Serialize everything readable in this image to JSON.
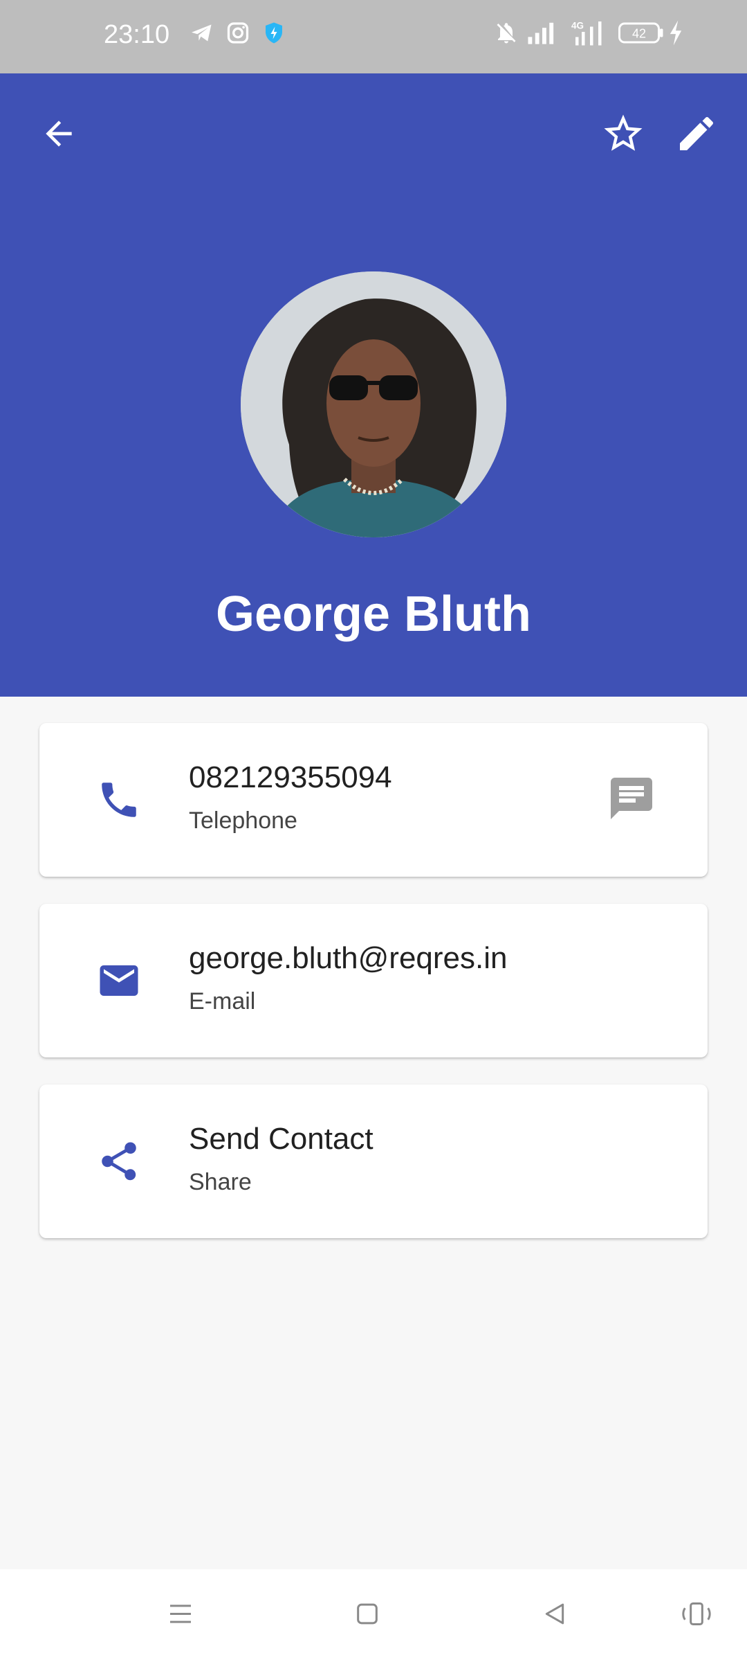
{
  "status_bar": {
    "time": "23:10",
    "left_icons": [
      "telegram-icon",
      "instagram-icon",
      "shield-bolt-icon"
    ],
    "right_icons": [
      "bell-off-icon",
      "signal-icon",
      "signal-4g-icon",
      "battery-icon",
      "charging-icon"
    ],
    "battery_level": "42"
  },
  "header": {
    "back_icon": "arrow-left-icon",
    "favorite_icon": "star-outline-icon",
    "edit_icon": "pencil-icon",
    "name": "George Bluth",
    "avatar_alt": "George Bluth avatar"
  },
  "cards": [
    {
      "icon": "phone-icon",
      "primary": "082129355094",
      "secondary": "Telephone",
      "action_icon": "message-icon"
    },
    {
      "icon": "email-icon",
      "primary": "george.bluth@reqres.in",
      "secondary": "E-mail"
    },
    {
      "icon": "share-icon",
      "primary": "Send Contact",
      "secondary": "Share"
    }
  ],
  "nav_bar": {
    "icons": [
      "menu-icon",
      "home-icon",
      "back-icon",
      "rotate-icon"
    ]
  },
  "colors": {
    "primary": "#3f51b5",
    "status_bar": "#bdbdbd",
    "background": "#f7f7f7",
    "secondary_icon": "#9e9e9e"
  }
}
